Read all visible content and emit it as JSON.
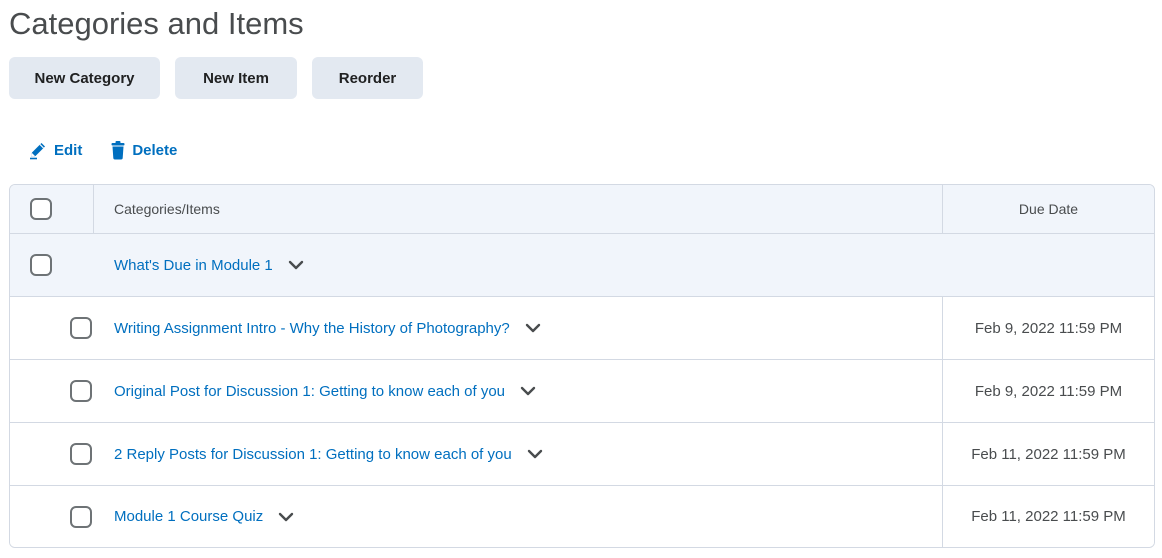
{
  "page": {
    "title": "Categories and Items"
  },
  "toolbar": {
    "new_category_label": "New Category",
    "new_item_label": "New Item",
    "reorder_label": "Reorder"
  },
  "actions": {
    "edit_label": "Edit",
    "delete_label": "Delete"
  },
  "table": {
    "columns": [
      "Categories/Items",
      "Due Date"
    ],
    "category": {
      "name": "What's Due in Module 1",
      "due": ""
    },
    "items": [
      {
        "name": "Writing Assignment Intro - Why the History of Photography?",
        "due": "Feb 9, 2022 11:59 PM"
      },
      {
        "name": "Original Post for Discussion 1: Getting to know each of you",
        "due": "Feb 9, 2022 11:59 PM"
      },
      {
        "name": "2 Reply Posts for Discussion 1: Getting to know each of you",
        "due": "Feb 11, 2022 11:59 PM"
      },
      {
        "name": "Module 1 Course Quiz",
        "due": "Feb 11, 2022 11:59 PM"
      }
    ]
  },
  "colors": {
    "link": "#006fbf",
    "button_bg": "#e3e9f1",
    "header_bg": "#f1f5fb",
    "border": "#d3d9e3"
  },
  "icons": {
    "edit": "pencil-icon",
    "delete": "trash-icon",
    "expand": "chevron-down-icon"
  }
}
